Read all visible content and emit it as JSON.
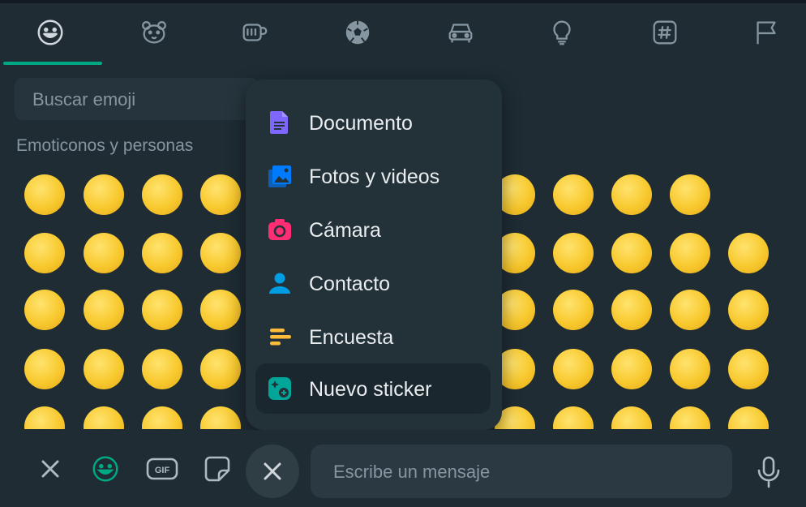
{
  "tabs": [
    {
      "icon": "smiley-icon",
      "active": true
    },
    {
      "icon": "bear-face-icon"
    },
    {
      "icon": "coffee-cup-icon"
    },
    {
      "icon": "soccer-ball-icon"
    },
    {
      "icon": "car-icon"
    },
    {
      "icon": "lightbulb-icon"
    },
    {
      "icon": "hashtag-icon"
    },
    {
      "icon": "flag-icon"
    }
  ],
  "search": {
    "placeholder": "Buscar emoji"
  },
  "category": {
    "title": "Emoticonos y personas"
  },
  "attach_menu": {
    "items": [
      {
        "label": "Documento",
        "icon": "document-icon",
        "color": "#7f66ff"
      },
      {
        "label": "Fotos y videos",
        "icon": "gallery-icon",
        "color": "#007bfc"
      },
      {
        "label": "Cámara",
        "icon": "camera-icon",
        "color": "#ff2e74"
      },
      {
        "label": "Contacto",
        "icon": "contact-icon",
        "color": "#009de2"
      },
      {
        "label": "Encuesta",
        "icon": "poll-icon",
        "color": "#ffbc38"
      },
      {
        "label": "Nuevo sticker",
        "icon": "new-sticker-icon",
        "color": "#02a698",
        "highlighted": true
      }
    ]
  },
  "emoji_rows": [
    [
      "😀",
      "😃",
      "😄",
      "😁",
      "😆",
      "😅",
      "😂",
      "🤣",
      "🥲",
      "☺️",
      "😊",
      "😇"
    ],
    [
      "🙂",
      "🙃",
      "😉",
      "😌",
      "😍",
      "🥰",
      "😘",
      "😗",
      "😙",
      "😚",
      "😋",
      "😛",
      "😝"
    ],
    [
      "😜",
      "🤪",
      "🤨",
      "🧐",
      "🤓",
      "😎",
      "🥸",
      "🤩",
      "🥳",
      "😏",
      "😒",
      "😞",
      "😔"
    ],
    [
      "😟",
      "😕",
      "🙁",
      "☹️",
      "😣",
      "😖",
      "😫",
      "😩",
      "🥺",
      "😢",
      "😭",
      "😤",
      "😠"
    ],
    [
      "😡",
      "🤬",
      "🤯",
      "😳",
      "🥵",
      "🥶",
      "😱",
      "😨",
      "😰",
      "😥",
      "😓",
      "🤗",
      "🤔"
    ]
  ],
  "message_input": {
    "placeholder": "Escribe un mensaje"
  },
  "colors": {
    "accent": "#00a884",
    "background": "#1f2c34",
    "menu": "#233138"
  }
}
